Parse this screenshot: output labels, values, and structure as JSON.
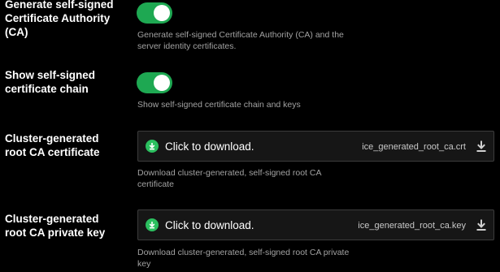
{
  "colors": {
    "background": "#000000",
    "toggle_on": "#1ea852",
    "download_accent": "#2bbf5f",
    "help_text": "#a2a2a2"
  },
  "settings": [
    {
      "label": "Generate self-signed Certificate Authority (CA)",
      "control": "toggle",
      "enabled": true,
      "help": "Generate self-signed Certificate Authority (CA) and the server identity certificates."
    },
    {
      "label": "Show self-signed certificate chain",
      "control": "toggle",
      "enabled": true,
      "help": "Show self-signed certificate chain and keys"
    },
    {
      "label": "Cluster-generated root CA certificate",
      "control": "download",
      "action_text": "Click to download.",
      "filename": "ice_generated_root_ca.crt",
      "help": "Download cluster-generated, self-signed root CA certificate"
    },
    {
      "label": "Cluster-generated root CA private key",
      "control": "download",
      "action_text": "Click to download.",
      "filename": "ice_generated_root_ca.key",
      "help": "Download cluster-generated, self-signed root CA private key"
    }
  ]
}
